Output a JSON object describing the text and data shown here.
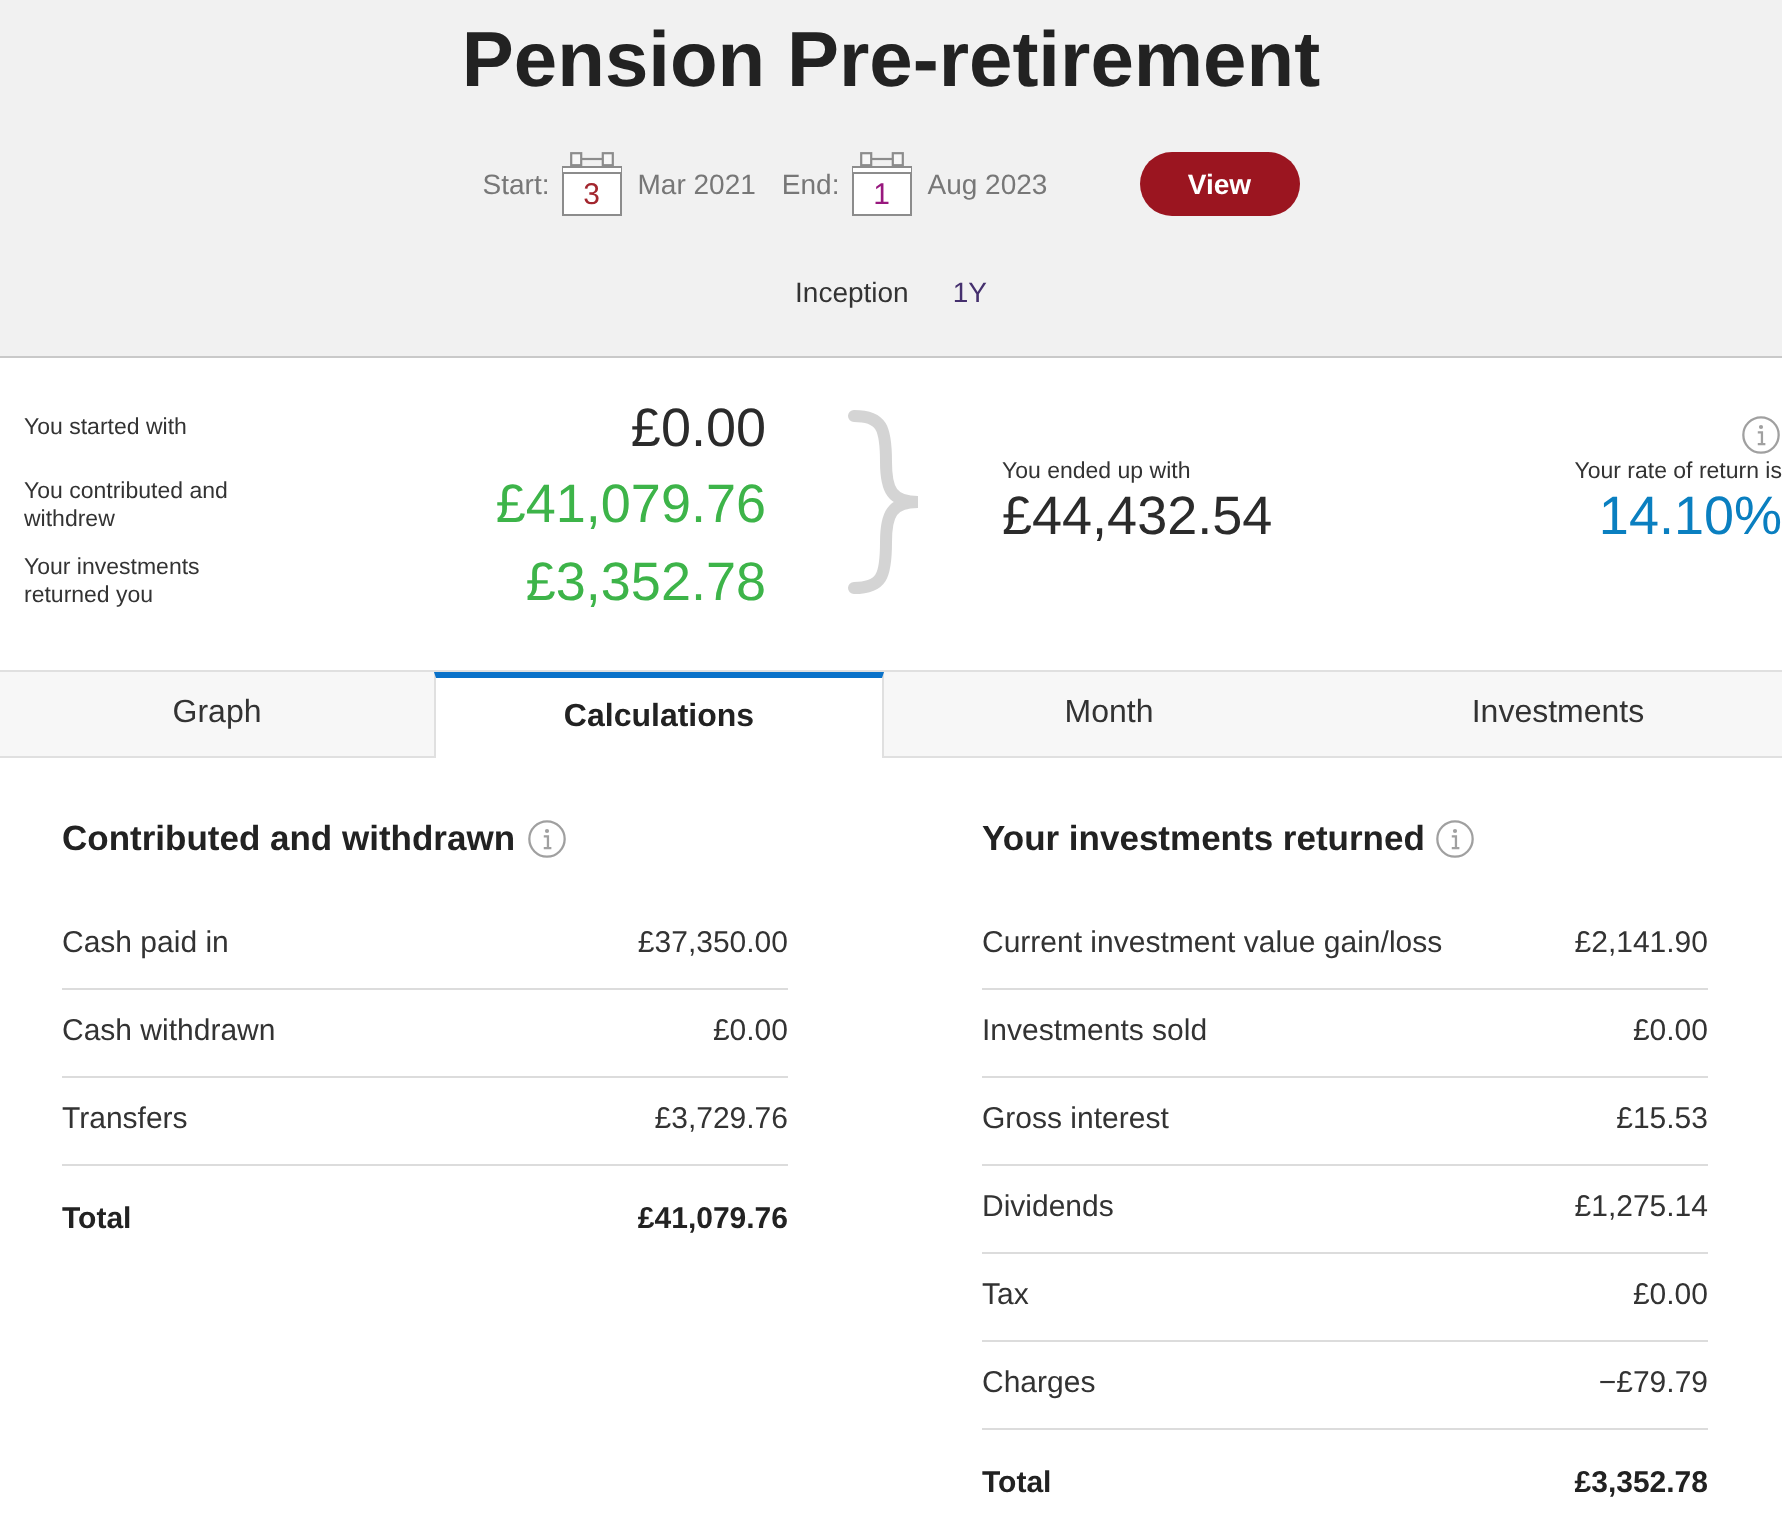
{
  "header": {
    "title": "Pension Pre-retirement",
    "dates": [
      {
        "label": "Start:",
        "day": "3",
        "month_year": "Mar 2021",
        "color": "#a3262e"
      },
      {
        "label": "End:",
        "day": "1",
        "month_year": "Aug 2023",
        "color": "#98187e"
      }
    ],
    "view_button": "View",
    "periods": [
      {
        "label": "Inception",
        "visited": false
      },
      {
        "label": "1Y",
        "visited": true
      }
    ]
  },
  "summary": {
    "items": [
      {
        "label": "You started with",
        "value": "£0.00",
        "kind": "neutral"
      },
      {
        "label": "You contributed and withdrew",
        "value": "£41,079.76",
        "kind": "positive"
      },
      {
        "label": "Your investments returned you",
        "value": "£3,352.78",
        "kind": "positive"
      }
    ],
    "ended": {
      "label": "You ended up with",
      "value": "£44,432.54"
    },
    "rate": {
      "label": "Your rate of return is",
      "value": "14.10%"
    }
  },
  "tabs": [
    {
      "label": "Graph",
      "selected": false
    },
    {
      "label": "Calculations",
      "selected": true
    },
    {
      "label": "Month",
      "selected": false
    },
    {
      "label": "Investments",
      "selected": false
    }
  ],
  "sections": [
    {
      "title": "Contributed and withdrawn",
      "rows": [
        {
          "label": "Cash paid in",
          "value": "£37,350.00"
        },
        {
          "label": "Cash withdrawn",
          "value": "£0.00"
        },
        {
          "label": "Transfers",
          "value": "£3,729.76"
        }
      ],
      "total": {
        "label": "Total",
        "value": "£41,079.76"
      }
    },
    {
      "title": "Your investments returned",
      "rows": [
        {
          "label": "Current investment value gain/loss",
          "value": "£2,141.90"
        },
        {
          "label": "Investments sold",
          "value": "£0.00"
        },
        {
          "label": "Gross interest",
          "value": "£15.53"
        },
        {
          "label": "Dividends",
          "value": "£1,275.14"
        },
        {
          "label": "Tax",
          "value": "£0.00"
        },
        {
          "label": "Charges",
          "value": "−£79.79"
        }
      ],
      "total": {
        "label": "Total",
        "value": "£3,352.78"
      }
    }
  ]
}
